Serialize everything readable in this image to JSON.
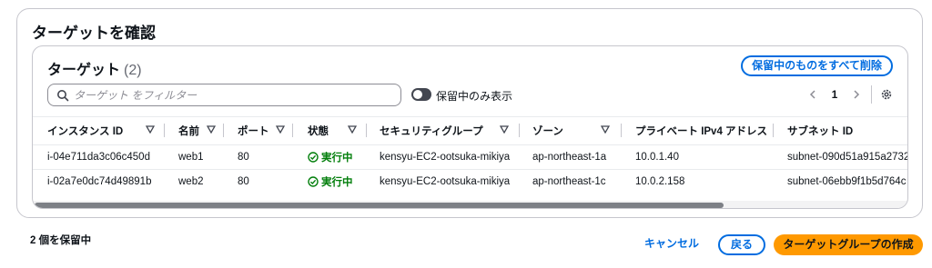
{
  "section": {
    "title": "ターゲットを確認"
  },
  "table": {
    "title": "ターゲット",
    "count": "(2)",
    "remove_all_label": "保留中のものをすべて削除",
    "filter_placeholder": "ターゲット をフィルター",
    "toggle_label": "保留中のみ表示",
    "page_number": "1",
    "columns": [
      "インスタンス ID",
      "名前",
      "ポート",
      "状態",
      "セキュリティグループ",
      "ゾーン",
      "プライベート IPv4 アドレス",
      "サブネット ID"
    ],
    "rows": [
      {
        "instance_id": "i-04e711da3c06c450d",
        "name": "web1",
        "port": "80",
        "status": "実行中",
        "security_group": "kensyu-EC2-ootsuka-mikiya",
        "zone": "ap-northeast-1a",
        "private_ip": "10.0.1.40",
        "subnet_id": "subnet-090d51a915a2732"
      },
      {
        "instance_id": "i-02a7e0dc74d49891b",
        "name": "web2",
        "port": "80",
        "status": "実行中",
        "security_group": "kensyu-EC2-ootsuka-mikiya",
        "zone": "ap-northeast-1c",
        "private_ip": "10.0.2.158",
        "subnet_id": "subnet-06ebb9f1b5d764c"
      }
    ]
  },
  "footer": {
    "pending_count": "2 個を保留中",
    "cancel_label": "キャンセル",
    "back_label": "戻る",
    "create_label": "ターゲットグループの作成"
  },
  "colors": {
    "primary": "#ff9900",
    "link": "#006ce0",
    "success": "#037f0c"
  }
}
